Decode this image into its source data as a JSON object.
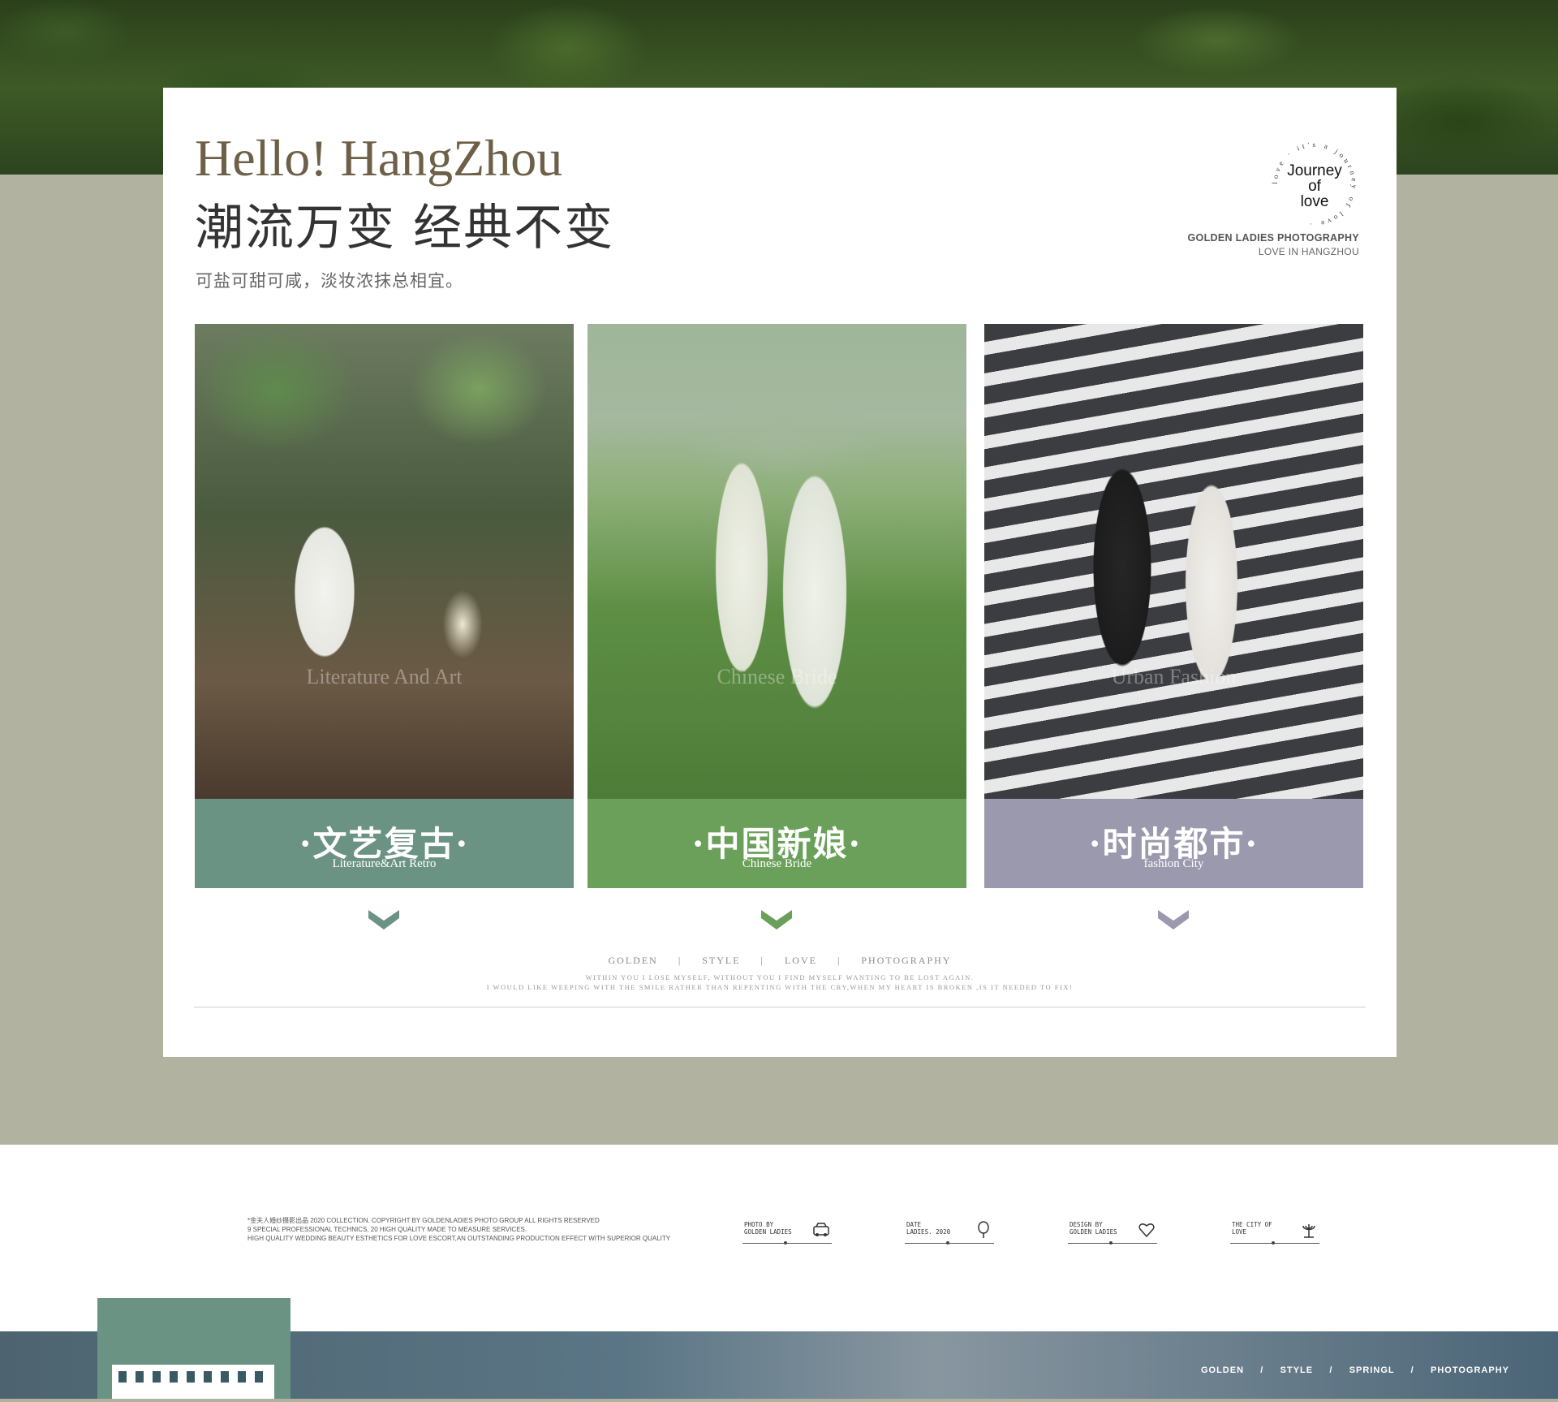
{
  "header": {
    "title_en": "Hello! HangZhou",
    "title_cn": "潮流万变 经典不变",
    "tagline": "可盐可甜可咸，淡妆浓抹总相宜。",
    "stamp_ring_text": "love · it's a journey of love · ",
    "stamp_line1": "Journey",
    "stamp_line2": "of",
    "stamp_line3": "love",
    "studio": "GOLDEN LADIES PHOTOGRAPHY",
    "studio_sub": "LOVE IN HANGZHOU"
  },
  "panels": [
    {
      "label_cn": "·文艺复古·",
      "label_en": "Literature&Art Retro",
      "watermark": "Literature And Art",
      "color": "#6b9384",
      "chevron_color": "#6b9384"
    },
    {
      "label_cn": "·中国新娘·",
      "label_en": "Chinese Bride",
      "watermark": "Chinese Bride",
      "color": "#6aa05a",
      "chevron_color": "#6aa05a"
    },
    {
      "label_cn": "·时尚都市·",
      "label_en": "fashion City",
      "watermark": "Urban Fashion",
      "color": "#9a99ad",
      "chevron_color": "#9a99ad"
    }
  ],
  "tagrow": "GOLDEN     |     STYLE     |     LOVE     |     PHOTOGRAPHY",
  "quote_line1": "WITHIN YOU I LOSE MYSELF, WITHOUT YOU I FIND MYSELF WANTING TO BE LOST AGAIN.",
  "quote_line2": "I WOULD LIKE WEEPING WITH THE SMILE RATHER THAN REPENTING WITH THE CRY,WHEN MY HEART IS BROKEN ,IS IT NEEDED TO FIX!",
  "copyright": {
    "line1": "*金夫人婚纱摄影出品 2020 COLLECTION. COPYRIGHT BY GOLDENLADIES PHOTO GROUP ALL RIGHTS RESERVED",
    "line2": "9 SPECIAL PROFESSIONAL TECHNICS, 20 HIGH QUALITY MADE TO MEASURE SERVICES.",
    "line3": "HIGH QUALITY WEDDING BEAUTY ESTHETICS FOR LOVE ESCORT,AN OUTSTANDING PRODUCTION EFFECT WITH SUPERIOR QUALITY"
  },
  "info_items": [
    {
      "text": "PHOTO BY\nGOLDEN LADIES",
      "icon": "car-icon"
    },
    {
      "text": "DATE\nLADIES. 2020",
      "icon": "balloon-icon"
    },
    {
      "text": "DESIGN BY\nGOLDEN LADIES",
      "icon": "heart-icon"
    },
    {
      "text": "THE CITY OF\nLOVE",
      "icon": "candelabra-icon"
    }
  ],
  "bottom_nav": "GOLDEN     /     STYLE     /     SPRINGL     /     PHOTOGRAPHY"
}
